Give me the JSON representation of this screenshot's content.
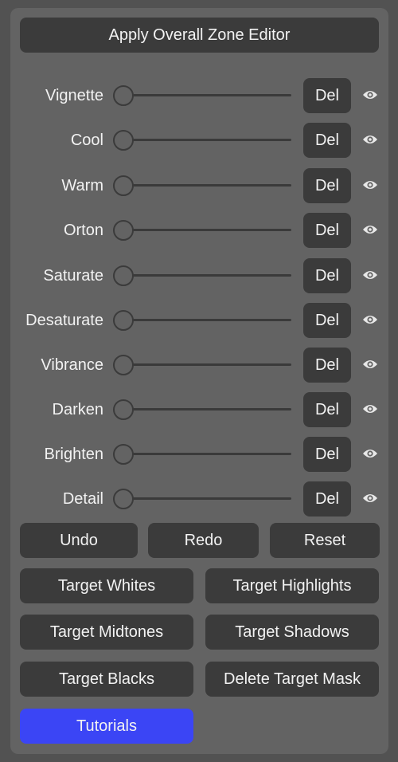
{
  "apply_button": "Apply Overall Zone Editor",
  "adjustments": [
    {
      "label": "Vignette",
      "del": "Del"
    },
    {
      "label": "Cool",
      "del": "Del"
    },
    {
      "label": "Warm",
      "del": "Del"
    },
    {
      "label": "Orton",
      "del": "Del"
    },
    {
      "label": "Saturate",
      "del": "Del"
    },
    {
      "label": "Desaturate",
      "del": "Del"
    },
    {
      "label": "Vibrance",
      "del": "Del"
    },
    {
      "label": "Darken",
      "del": "Del"
    },
    {
      "label": "Brighten",
      "del": "Del"
    },
    {
      "label": "Detail",
      "del": "Del"
    }
  ],
  "history": {
    "undo": "Undo",
    "redo": "Redo",
    "reset": "Reset"
  },
  "targets": {
    "whites": "Target Whites",
    "highlights": "Target Highlights",
    "midtones": "Target Midtones",
    "shadows": "Target Shadows",
    "blacks": "Target Blacks",
    "delete_mask": "Delete Target Mask"
  },
  "tutorials": "Tutorials",
  "colors": {
    "background": "#525252",
    "panel": "#636363",
    "button": "#3b3b3b",
    "accent": "#3b45f5"
  },
  "icons": {
    "visibility": "eye-icon"
  }
}
